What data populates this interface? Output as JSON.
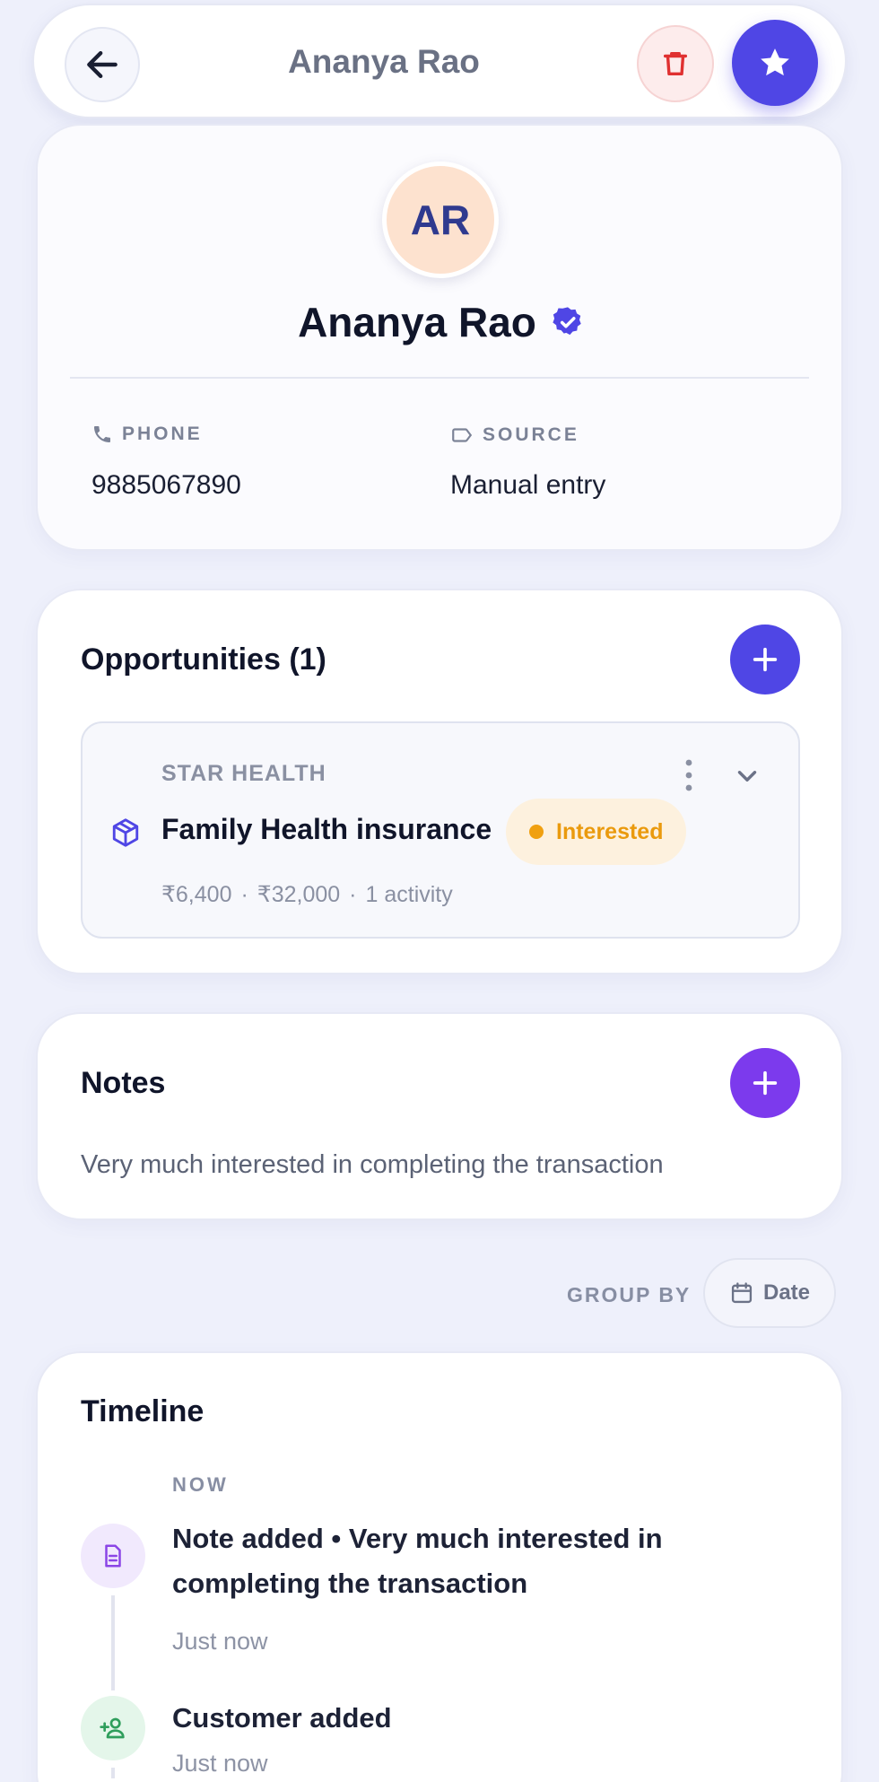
{
  "header": {
    "title": "Ananya Rao"
  },
  "profile": {
    "initials": "AR",
    "name": "Ananya Rao",
    "phone_label": "PHONE",
    "phone_value": "9885067890",
    "source_label": "SOURCE",
    "source_value": "Manual entry"
  },
  "opportunities": {
    "title": "Opportunities (1)",
    "items": [
      {
        "company": "STAR HEALTH",
        "title": "Family Health insurance",
        "status": "Interested",
        "amount": "₹6,400",
        "value": "₹32,000",
        "activity": "1 activity"
      }
    ]
  },
  "notes": {
    "title": "Notes",
    "text": "Very much interested in completing the transaction"
  },
  "group_by": {
    "label": "GROUP BY",
    "value": "Date"
  },
  "timeline": {
    "title": "Timeline",
    "group_label": "NOW",
    "events": [
      {
        "title": "Note added • Very much interested in completing the transaction",
        "time": "Just now"
      },
      {
        "title": "Customer added",
        "time": "Just now"
      }
    ]
  },
  "colors": {
    "accent": "#4f46e5",
    "notes_accent": "#7c3aed",
    "danger": "#e03131",
    "status_interested": "#ea9a0d"
  }
}
